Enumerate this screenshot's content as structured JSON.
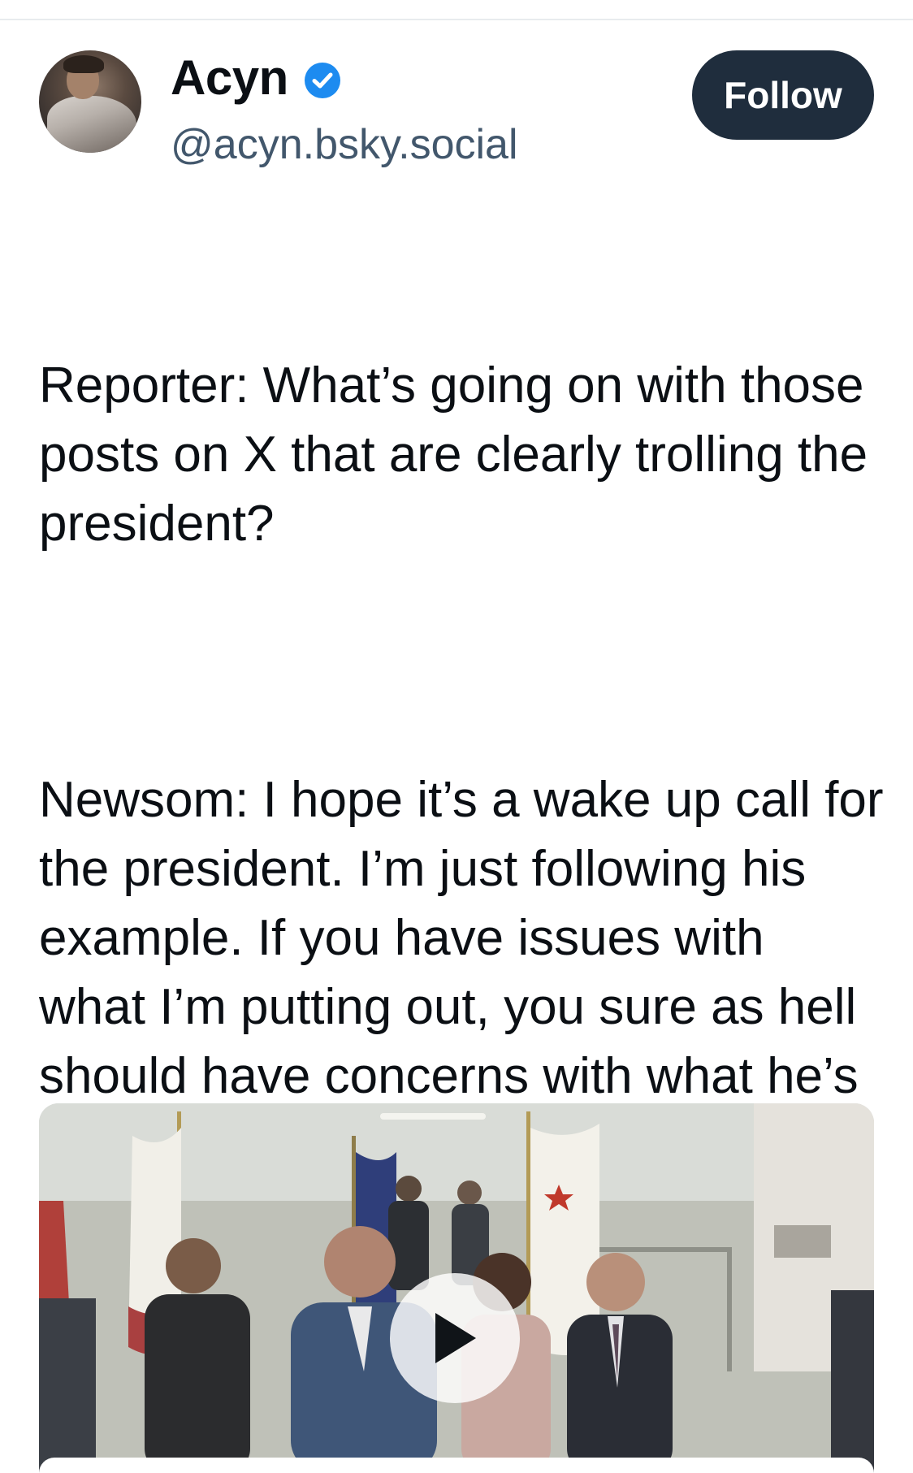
{
  "author": {
    "display_name": "Acyn",
    "handle": "@acyn.bsky.social",
    "verified_icon": "verified-check-icon",
    "avatar_icon": "avatar"
  },
  "actions": {
    "follow_label": "Follow"
  },
  "post": {
    "paragraph_1": "Reporter: What’s going on with those posts on X that are clearly trolling the president?",
    "paragraph_2": "Newsom: I hope it’s a wake up call for the president. I’m just following his example. If you have issues with what I’m putting out, you sure as hell should have concerns with what he’s putting out"
  },
  "media": {
    "type": "video",
    "play_icon": "play-icon"
  },
  "colors": {
    "follow_bg": "#1f2d3d",
    "verified_blue": "#1d8bf0",
    "handle_gray": "#42576c"
  }
}
